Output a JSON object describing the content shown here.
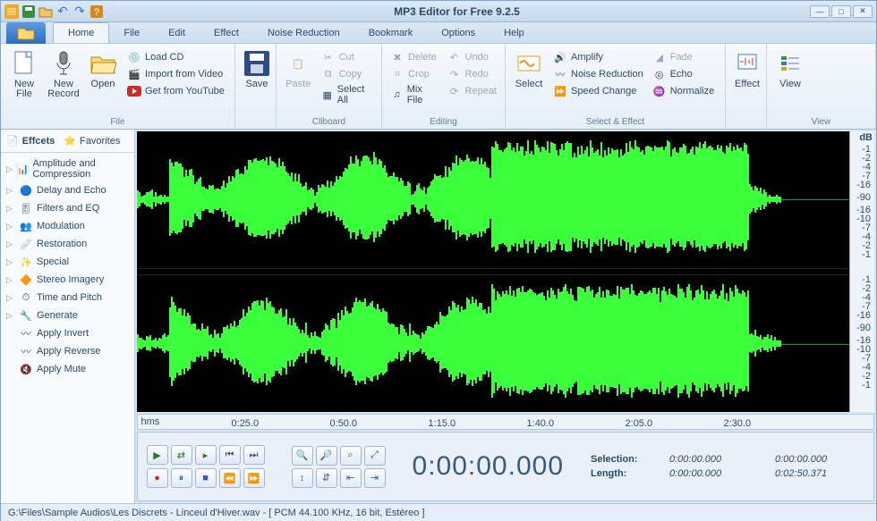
{
  "app_title": "MP3 Editor for Free 9.2.5",
  "menu_tabs": [
    "Home",
    "File",
    "Edit",
    "Effect",
    "Noise Reduction",
    "Bookmark",
    "Options",
    "Help"
  ],
  "active_tab": "Home",
  "ribbon": {
    "file": {
      "label": "File",
      "new_file": "New\nFile",
      "new_record": "New\nRecord",
      "open": "Open",
      "load_cd": "Load CD",
      "import_video": "Import from Video",
      "get_youtube": "Get from YouTube"
    },
    "save": {
      "save": "Save"
    },
    "clipboard": {
      "label": "Cliboard",
      "paste": "Paste",
      "cut": "Cut",
      "copy": "Copy",
      "select_all": "Select All"
    },
    "editing": {
      "label": "Editing",
      "delete": "Delete",
      "crop": "Crop",
      "mix": "Mix File",
      "undo": "Undo",
      "redo": "Redo",
      "repeat": "Repeat"
    },
    "select_effect": {
      "label": "Select & Effect",
      "select": "Select",
      "amplify": "Amplify",
      "noise_reduction": "Noise Reduction",
      "speed_change": "Speed Change",
      "fade": "Fade",
      "echo": "Echo",
      "normalize": "Normalize"
    },
    "effect": {
      "effect": "Effect"
    },
    "view": {
      "label": "View",
      "view": "View"
    }
  },
  "sidebar": {
    "tabs": {
      "effects": "Effcets",
      "favorites": "Favorites"
    },
    "items": [
      {
        "label": "Amplitude and Compression",
        "expand": true
      },
      {
        "label": "Delay and Echo",
        "expand": true
      },
      {
        "label": "Filters and EQ",
        "expand": true
      },
      {
        "label": "Modulation",
        "expand": true
      },
      {
        "label": "Restoration",
        "expand": true
      },
      {
        "label": "Special",
        "expand": true
      },
      {
        "label": "Stereo Imagery",
        "expand": true
      },
      {
        "label": "Time and Pitch",
        "expand": true
      },
      {
        "label": "Generate",
        "expand": true
      },
      {
        "label": "Apply Invert",
        "expand": false
      },
      {
        "label": "Apply Reverse",
        "expand": false
      },
      {
        "label": "Apply Mute",
        "expand": false
      }
    ]
  },
  "db_scale": {
    "header": "dB",
    "ticks": [
      "-1",
      "-2",
      "-4",
      "-7",
      "-16",
      "-90",
      "-16",
      "-10",
      "-7",
      "-4",
      "-2",
      "-1"
    ]
  },
  "timeline": {
    "unit": "hms",
    "ticks": [
      "0:25.0",
      "0:50.0",
      "1:15.0",
      "1:40.0",
      "2:05.0",
      "2:30.0"
    ]
  },
  "counter": "0:00:00.000",
  "info": {
    "selection_label": "Selection:",
    "length_label": "Length:",
    "sel_start": "0:00:00.000",
    "sel_end": "0:00:00.000",
    "len_start": "0:00:00.000",
    "len_end": "0:02:50.371"
  },
  "status": "G:\\Files\\Sample Audios\\Les Discrets - Linceul d'Hiver.wav - [ PCM 44.100 KHz, 16 bit, Estéreo ]"
}
